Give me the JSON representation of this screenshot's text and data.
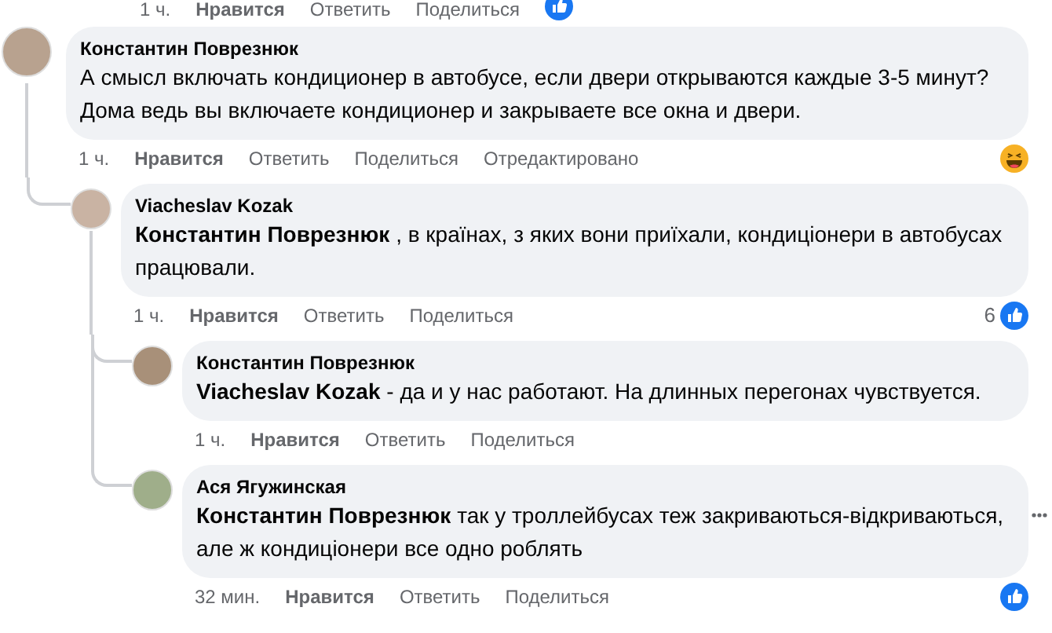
{
  "top_partial_actions": {
    "time": "1 ч.",
    "actions": [
      "Нравится",
      "Ответить",
      "Поделиться"
    ],
    "reaction": {
      "kind": "like"
    }
  },
  "comments": [
    {
      "author": "Константин Поврезнюк",
      "text": "А смысл включать кондиционер в автобусе, если двери открываются каждые 3-5 минут? Дома ведь вы включаете кондиционер и закрываете все окна и двери.",
      "time": "1 ч.",
      "actions": [
        "Нравится",
        "Ответить",
        "Поделиться"
      ],
      "edited": "Отредактировано",
      "reaction": {
        "kind": "haha"
      },
      "children": [
        {
          "author": "Viacheslav Kozak",
          "text": "**Константин Поврезнюк** , в країнах, з яких вони приїхали, кондиціонери в автобусах працювали.",
          "time": "1 ч.",
          "actions": [
            "Нравится",
            "Ответить",
            "Поделиться"
          ],
          "reaction": {
            "kind": "like",
            "count": "6"
          },
          "children": [
            {
              "author": "Константин Поврезнюк",
              "text": "**Viacheslav Kozak** - да и у нас работают. На длинных перегонах чувствуется.",
              "time": "1 ч.",
              "actions": [
                "Нравится",
                "Ответить",
                "Поделиться"
              ]
            },
            {
              "author": "Ася Ягужинская",
              "text": "**Константин Поврезнюк** так у троллейбусах теж закриваються-відкриваються, але ж кондиціонери все одно роблять",
              "time": "32 мин.",
              "actions": [
                "Нравится",
                "Ответить",
                "Поделиться"
              ],
              "reaction": {
                "kind": "like"
              }
            }
          ]
        }
      ]
    }
  ]
}
